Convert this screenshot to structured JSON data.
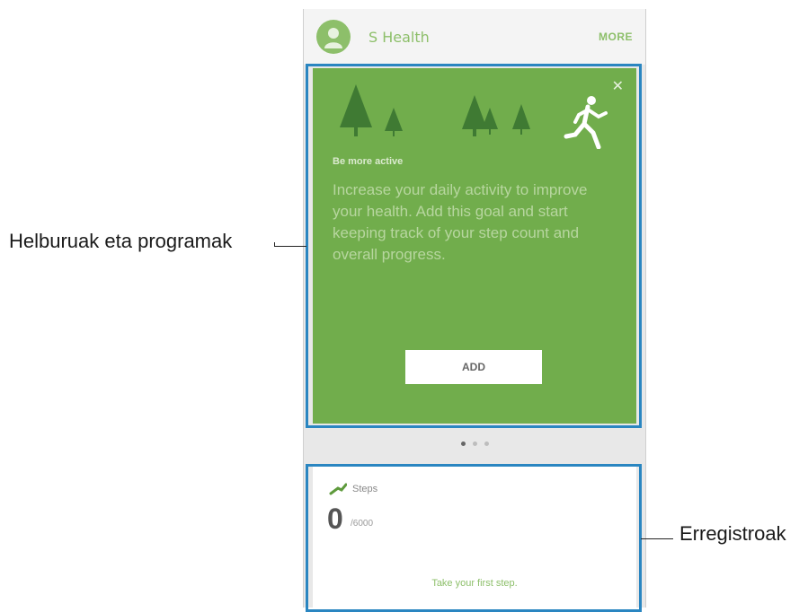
{
  "header": {
    "app_title": "S Health",
    "more_label": "MORE"
  },
  "goal_card": {
    "heading": "Be more active",
    "body": "Increase your daily activity to improve your health. Add this goal and start keeping track of your step count and overall progress.",
    "add_label": "ADD"
  },
  "pager": {
    "count": 3,
    "active_index": 0
  },
  "steps_card": {
    "label": "Steps",
    "value": "0",
    "unit": "/6000",
    "hint": "Take your first step."
  },
  "callouts": {
    "goals": "Helburuak eta programak",
    "records": "Erregistroak"
  },
  "colors": {
    "accent_green": "#71ad4c",
    "highlight_blue": "#2a86c1"
  },
  "icons": [
    "avatar-icon",
    "close-icon",
    "tree-icon",
    "runner-icon",
    "steps-icon"
  ]
}
